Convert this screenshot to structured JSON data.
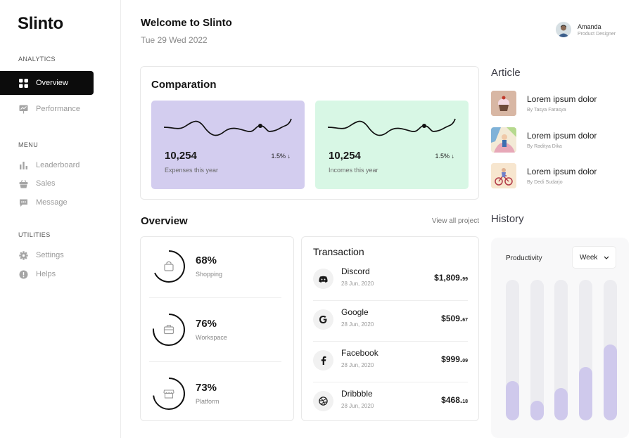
{
  "app": {
    "name": "Slinto"
  },
  "sidebar": {
    "analytics_label": "ANALYTICS",
    "menu_label": "MENU",
    "utilities_label": "UTILITIES",
    "items": [
      {
        "label": "Overview",
        "icon": "grid-icon",
        "active": true
      },
      {
        "label": "Performance",
        "icon": "presentation-icon"
      },
      {
        "label": "Leaderboard",
        "icon": "bar-chart-icon"
      },
      {
        "label": "Sales",
        "icon": "basket-icon"
      },
      {
        "label": "Message",
        "icon": "chat-icon"
      },
      {
        "label": "Settings",
        "icon": "gear-icon"
      },
      {
        "label": "Helps",
        "icon": "info-icon"
      }
    ]
  },
  "header": {
    "welcome": "Welcome to Slinto",
    "date": "Tue 29 Wed 2022",
    "user": {
      "name": "Amanda",
      "role": "Product Designer"
    }
  },
  "comparation": {
    "title": "Comparation",
    "expenses": {
      "value": "10,254",
      "caption": "Expenses this year",
      "change": "1.5%",
      "color": "#d3cdef"
    },
    "incomes": {
      "value": "10,254",
      "caption": "Incomes this year",
      "change": "1.5%",
      "color": "#d8f7e5"
    }
  },
  "overview": {
    "title": "Overview",
    "view_all": "View all project",
    "items": [
      {
        "percent": "68%",
        "label": "Shopping",
        "value": 0.68,
        "icon": "bag-icon"
      },
      {
        "percent": "76%",
        "label": "Workspace",
        "value": 0.76,
        "icon": "briefcase-icon"
      },
      {
        "percent": "73%",
        "label": "Platform",
        "value": 0.73,
        "icon": "store-icon"
      }
    ]
  },
  "transaction": {
    "title": "Transaction",
    "items": [
      {
        "name": "Discord",
        "date": "28 Jun, 2020",
        "amount": "$1,809.",
        "cents": "99",
        "icon": "discord-icon"
      },
      {
        "name": "Google",
        "date": "28 Jun, 2020",
        "amount": "$509.",
        "cents": "67",
        "icon": "google-icon"
      },
      {
        "name": "Facebook",
        "date": "28 Jun, 2020",
        "amount": "$999.",
        "cents": "09",
        "icon": "facebook-icon"
      },
      {
        "name": "Dribbble",
        "date": "28 Jun, 2020",
        "amount": "$468.",
        "cents": "18",
        "icon": "dribbble-icon"
      }
    ]
  },
  "article": {
    "title": "Article",
    "items": [
      {
        "title": "Lorem ipsum dolor",
        "author": "By Tasya Farasya"
      },
      {
        "title": "Lorem ipsum dolor",
        "author": "By Raditya Dika"
      },
      {
        "title": "Lorem ipsum dolor",
        "author": "By Dedi Sudarjo"
      }
    ]
  },
  "history": {
    "title": "History",
    "productivity_label": "Productivity",
    "period": "Week",
    "bars": [
      0.28,
      0.14,
      0.23,
      0.38,
      0.54
    ],
    "accent": "#cfc9ec"
  }
}
